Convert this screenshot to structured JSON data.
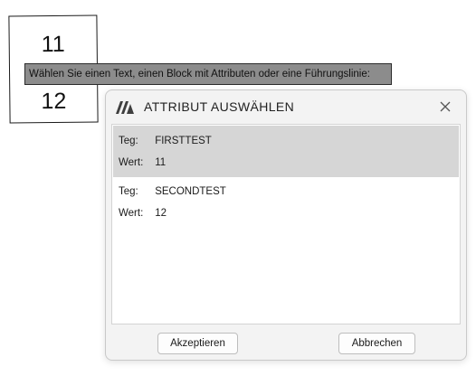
{
  "drawing": {
    "attribute_values": [
      "11",
      "12"
    ]
  },
  "prompt": {
    "text": "Wählen Sie einen Text, einen Block mit Attributen oder eine Führungslinie:"
  },
  "dialog": {
    "title": "ATTRIBUT AUSWÄHLEN",
    "logo_icon": "app-logo-icon",
    "close_icon": "close-icon",
    "items": [
      {
        "tag_label": "Teg:",
        "tag_value": "FIRSTTEST",
        "value_label": "Wert:",
        "value": "11",
        "selected": true
      },
      {
        "tag_label": "Teg:",
        "tag_value": "SECONDTEST",
        "value_label": "Wert:",
        "value": "12",
        "selected": false
      }
    ],
    "buttons": {
      "accept": "Akzeptieren",
      "cancel": "Abbrechen"
    },
    "colors": {
      "selection": "#d6d6d6",
      "logo": "#3f3f3f",
      "prompt_bg": "#8c8c8c"
    }
  }
}
